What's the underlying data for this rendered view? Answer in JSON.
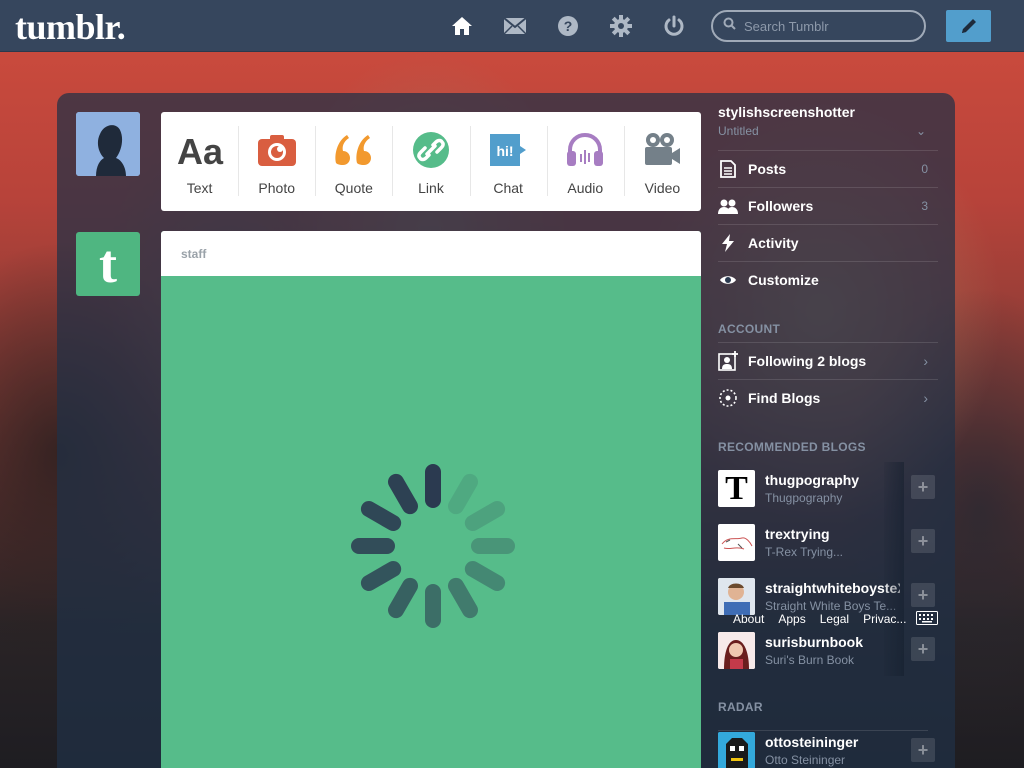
{
  "header": {
    "logo": "tumblr.",
    "search_placeholder": "Search Tumblr",
    "nav": [
      "home-icon",
      "mail-icon",
      "help-icon",
      "gear-icon",
      "power-icon"
    ],
    "compose_icon": "pencil-icon"
  },
  "post_types": [
    {
      "label": "Text",
      "icon": "text-icon",
      "color": "#444444"
    },
    {
      "label": "Photo",
      "icon": "camera-icon",
      "color": "#d95e40"
    },
    {
      "label": "Quote",
      "icon": "quote-icon",
      "color": "#f2992e"
    },
    {
      "label": "Link",
      "icon": "link-icon",
      "color": "#56bc8a"
    },
    {
      "label": "Chat",
      "icon": "chat-icon",
      "color": "#529ecc"
    },
    {
      "label": "Audio",
      "icon": "headphones-icon",
      "color": "#a77dc2"
    },
    {
      "label": "Video",
      "icon": "video-camera-icon",
      "color": "#748089"
    }
  ],
  "post": {
    "author": "staff",
    "background": "#56bc8a"
  },
  "sidebar": {
    "blog_name": "stylishscreenshotter",
    "blog_title": "Untitled",
    "stats": [
      {
        "label": "Posts",
        "count": "0",
        "icon": "posts-icon"
      },
      {
        "label": "Followers",
        "count": "3",
        "icon": "followers-icon"
      },
      {
        "label": "Activity",
        "count": "",
        "icon": "lightning-icon"
      },
      {
        "label": "Customize",
        "count": "",
        "icon": "eye-icon"
      }
    ],
    "account_title": "ACCOUNT",
    "account": [
      {
        "label": "Following 2 blogs",
        "icon": "add-person-icon"
      },
      {
        "label": "Find Blogs",
        "icon": "compass-icon"
      }
    ],
    "recommended_title": "RECOMMENDED BLOGS",
    "recommended": [
      {
        "name": "thugpography",
        "title": "Thugpography"
      },
      {
        "name": "trextrying",
        "title": "T-Rex Trying..."
      },
      {
        "name": "straightwhiteboysteXting",
        "title": "Straight White Boys Te..."
      },
      {
        "name": "surisburnbook",
        "title": "Suri's Burn Book"
      }
    ],
    "footer": [
      "About",
      "Apps",
      "Legal",
      "Privac..."
    ],
    "radar_title": "RADAR",
    "radar": {
      "name": "ottosteininger",
      "title": "Otto Steininger"
    }
  }
}
